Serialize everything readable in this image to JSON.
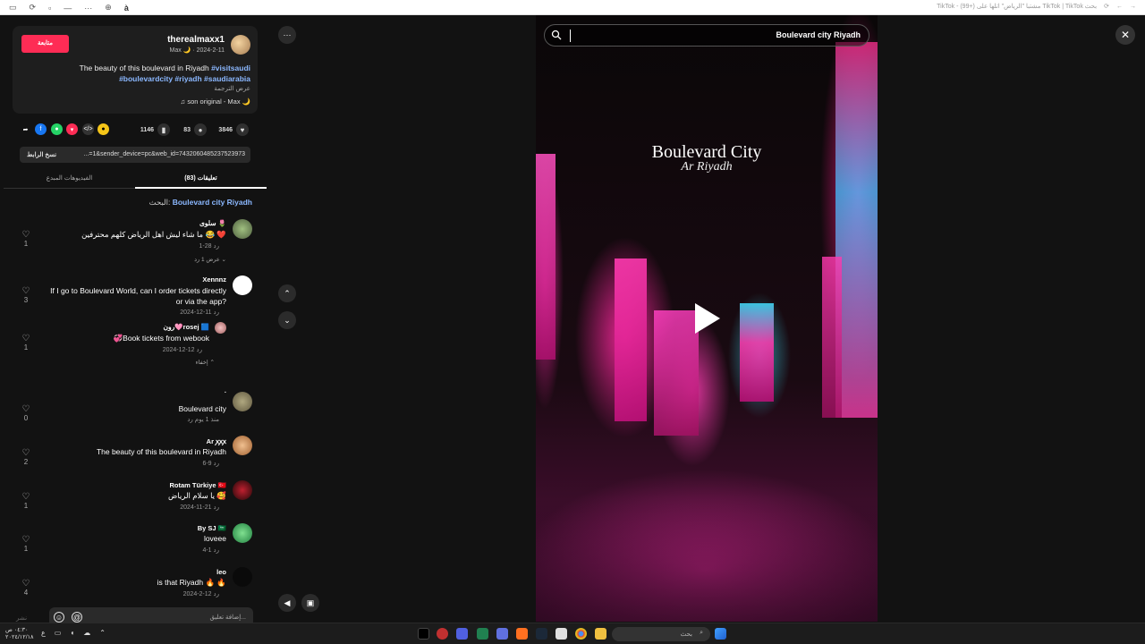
{
  "browser": {
    "tab_title": "TikTok - (99+) مشتبا \"الرياض\" اتلها على TikTok | TikTok بحث",
    "toolbar_text": "à"
  },
  "post": {
    "follow_label": "متابعة",
    "username": "therealmaxx1",
    "display_line": "Max 🌙 · 2024-2-11",
    "desc_line1_tag": "#visitsaudi",
    "desc_line1_text": "The beauty of this boulevard in Riyadh",
    "desc_line2": "#boulevardcity #riyadh #saudiarabia",
    "translate_label": "عرض الترجمة",
    "music": "♫ son original - Max 🌙"
  },
  "actions": {
    "likes": "3846",
    "comments": "83",
    "saves": "1146"
  },
  "link": {
    "copy_label": "نسخ الرابط",
    "url": "...=1&sender_device=pc&web_id=7432060485237523973"
  },
  "tabs": {
    "comments_label": "تعليقات (83)",
    "creator_videos_label": "الفيديوهات المبدع"
  },
  "search_hint": {
    "prefix": "البحث:",
    "query": "Boulevard city Riyadh"
  },
  "comments": [
    {
      "name": "سلوى 🌷",
      "text": "ما شاء ليش اهل الرياض كلهم محترفين 😂 ❤️",
      "meta": "1-28   رد",
      "likes": "1",
      "view_replies": "عرض 1 رد ⌄"
    },
    {
      "name": "Xennnz",
      "text": "If I go to Boulevard World, can I order tickets directly or via the app?",
      "meta": "2024-12-11   رد",
      "likes": "3"
    },
    {
      "name": "رون🩷rosej 🟦",
      "text": "💞Book tickets from webook",
      "meta": "2024-12-12   رد",
      "likes": "1",
      "hide_label": "إخفاء ⌃"
    },
    {
      "name": ".",
      "text": "Boulevard city",
      "meta": "منذ 1 يوم   رد",
      "likes": "0"
    },
    {
      "name": "Ar ꭗꭗꭗ",
      "text": "The beauty of this boulevard in Riyadh",
      "meta": "6-9   رد",
      "likes": "2"
    },
    {
      "name": "Rotam Türkiye 🇹🇷",
      "text": "يا سلام الرياض 🥰",
      "meta": "2024-11-21   رد",
      "likes": "1"
    },
    {
      "name": "By SJ 🇸🇦",
      "text": "loveee",
      "meta": "4-1   رد",
      "likes": "1"
    },
    {
      "name": "leo",
      "text": "is that Riyadh 🔥 🔥",
      "meta": "2024-2-12   رد",
      "likes": "4"
    }
  ],
  "comment_box": {
    "placeholder": "إضافة تعليق...",
    "post_label": "نشر"
  },
  "video": {
    "search_text": "Boulevard city Riyadh",
    "title": "Boulevard City",
    "subtitle": "Ar Riyadh"
  },
  "taskbar": {
    "search_label": "بحث",
    "time": "٠٤:٣٠ ص",
    "date": "٢٠٢٤/١٢/١٨"
  },
  "colors": {
    "follow": "#fe2c55",
    "tag": "#8bb8ff"
  }
}
